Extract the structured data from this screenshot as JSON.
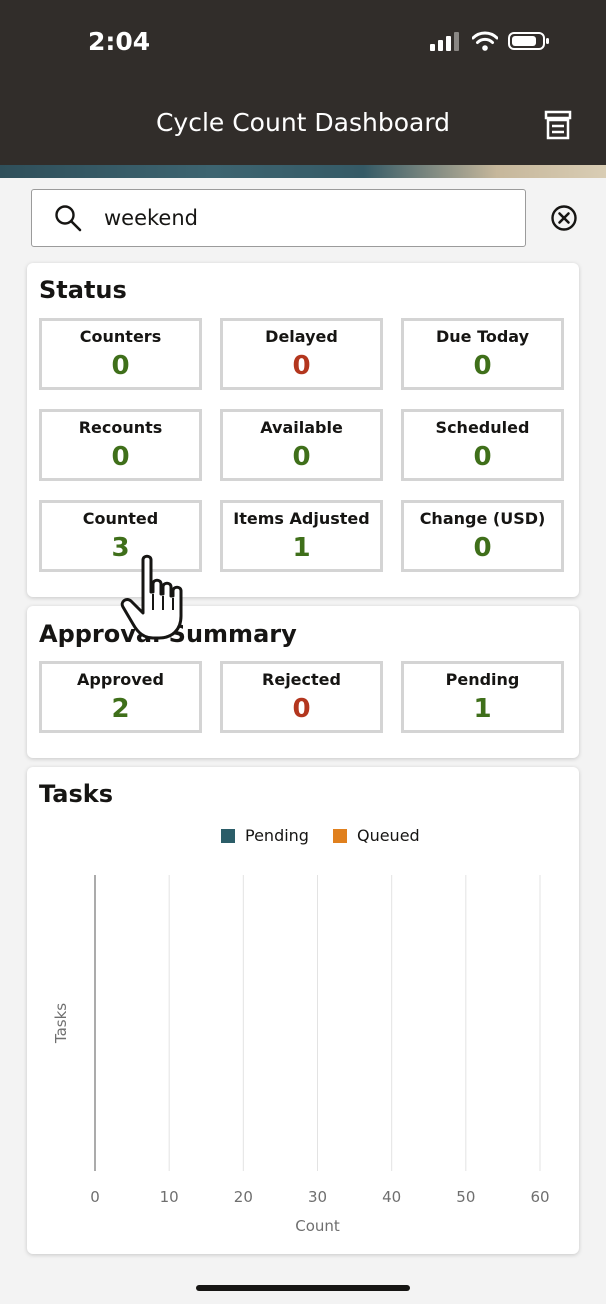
{
  "status_bar": {
    "time": "2:04"
  },
  "header": {
    "title": "Cycle Count Dashboard",
    "menu_icon": "report-list-icon"
  },
  "search": {
    "value": "weekend",
    "search_icon": "search-icon",
    "clear_icon": "close-circle-icon"
  },
  "status_card": {
    "title": "Status",
    "tiles": [
      {
        "label": "Counters",
        "value": "0",
        "color": "#3f6f1a"
      },
      {
        "label": "Delayed",
        "value": "0",
        "color": "#b3361e"
      },
      {
        "label": "Due Today",
        "value": "0",
        "color": "#3f6f1a"
      },
      {
        "label": "Recounts",
        "value": "0",
        "color": "#3f6f1a"
      },
      {
        "label": "Available",
        "value": "0",
        "color": "#3f6f1a"
      },
      {
        "label": "Scheduled",
        "value": "0",
        "color": "#3f6f1a"
      },
      {
        "label": "Counted",
        "value": "3",
        "color": "#3f6f1a"
      },
      {
        "label": "Items Adjusted",
        "value": "1",
        "color": "#3f6f1a"
      },
      {
        "label": "Change (USD)",
        "value": "0",
        "color": "#3f6f1a"
      }
    ]
  },
  "approval_card": {
    "title": "Approval Summary",
    "tiles": [
      {
        "label": "Approved",
        "value": "2",
        "color": "#3f6f1a"
      },
      {
        "label": "Rejected",
        "value": "0",
        "color": "#b3361e"
      },
      {
        "label": "Pending",
        "value": "1",
        "color": "#3f6f1a"
      }
    ]
  },
  "tasks_card": {
    "title": "Tasks"
  },
  "chart_data": {
    "type": "bar",
    "orientation": "horizontal",
    "title": "",
    "legend": [
      {
        "name": "Pending",
        "color": "#2b5d68"
      },
      {
        "name": "Queued",
        "color": "#e0801e"
      }
    ],
    "legend_position": "top",
    "series": [
      {
        "name": "Pending",
        "values": []
      },
      {
        "name": "Queued",
        "values": []
      }
    ],
    "categories": [],
    "xlabel": "Count",
    "ylabel": "Tasks",
    "xlim": [
      0,
      60
    ],
    "xticks": [
      0,
      10,
      20,
      30,
      40,
      50,
      60
    ],
    "grid": true
  },
  "cursor_icon": "hand-pointer-icon"
}
